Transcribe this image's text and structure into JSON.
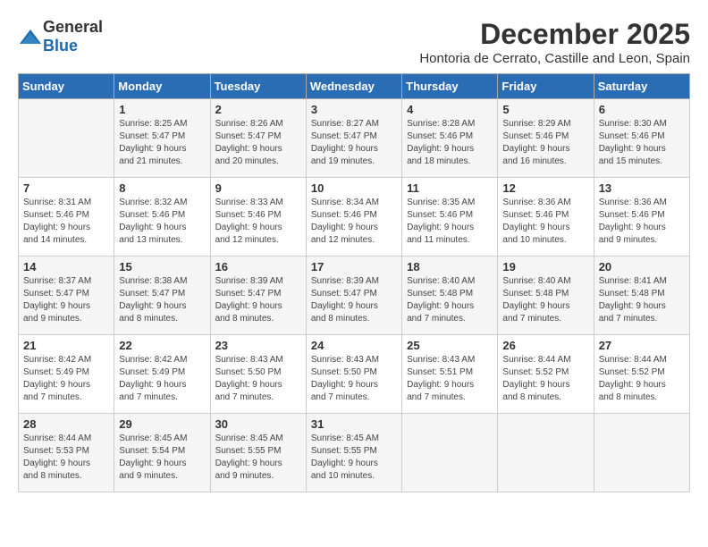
{
  "logo": {
    "text_general": "General",
    "text_blue": "Blue"
  },
  "title": "December 2025",
  "location": "Hontoria de Cerrato, Castille and Leon, Spain",
  "weekdays": [
    "Sunday",
    "Monday",
    "Tuesday",
    "Wednesday",
    "Thursday",
    "Friday",
    "Saturday"
  ],
  "weeks": [
    [
      {
        "day": "",
        "info": ""
      },
      {
        "day": "1",
        "info": "Sunrise: 8:25 AM\nSunset: 5:47 PM\nDaylight: 9 hours\nand 21 minutes."
      },
      {
        "day": "2",
        "info": "Sunrise: 8:26 AM\nSunset: 5:47 PM\nDaylight: 9 hours\nand 20 minutes."
      },
      {
        "day": "3",
        "info": "Sunrise: 8:27 AM\nSunset: 5:47 PM\nDaylight: 9 hours\nand 19 minutes."
      },
      {
        "day": "4",
        "info": "Sunrise: 8:28 AM\nSunset: 5:46 PM\nDaylight: 9 hours\nand 18 minutes."
      },
      {
        "day": "5",
        "info": "Sunrise: 8:29 AM\nSunset: 5:46 PM\nDaylight: 9 hours\nand 16 minutes."
      },
      {
        "day": "6",
        "info": "Sunrise: 8:30 AM\nSunset: 5:46 PM\nDaylight: 9 hours\nand 15 minutes."
      }
    ],
    [
      {
        "day": "7",
        "info": "Sunrise: 8:31 AM\nSunset: 5:46 PM\nDaylight: 9 hours\nand 14 minutes."
      },
      {
        "day": "8",
        "info": "Sunrise: 8:32 AM\nSunset: 5:46 PM\nDaylight: 9 hours\nand 13 minutes."
      },
      {
        "day": "9",
        "info": "Sunrise: 8:33 AM\nSunset: 5:46 PM\nDaylight: 9 hours\nand 12 minutes."
      },
      {
        "day": "10",
        "info": "Sunrise: 8:34 AM\nSunset: 5:46 PM\nDaylight: 9 hours\nand 12 minutes."
      },
      {
        "day": "11",
        "info": "Sunrise: 8:35 AM\nSunset: 5:46 PM\nDaylight: 9 hours\nand 11 minutes."
      },
      {
        "day": "12",
        "info": "Sunrise: 8:36 AM\nSunset: 5:46 PM\nDaylight: 9 hours\nand 10 minutes."
      },
      {
        "day": "13",
        "info": "Sunrise: 8:36 AM\nSunset: 5:46 PM\nDaylight: 9 hours\nand 9 minutes."
      }
    ],
    [
      {
        "day": "14",
        "info": "Sunrise: 8:37 AM\nSunset: 5:47 PM\nDaylight: 9 hours\nand 9 minutes."
      },
      {
        "day": "15",
        "info": "Sunrise: 8:38 AM\nSunset: 5:47 PM\nDaylight: 9 hours\nand 8 minutes."
      },
      {
        "day": "16",
        "info": "Sunrise: 8:39 AM\nSunset: 5:47 PM\nDaylight: 9 hours\nand 8 minutes."
      },
      {
        "day": "17",
        "info": "Sunrise: 8:39 AM\nSunset: 5:47 PM\nDaylight: 9 hours\nand 8 minutes."
      },
      {
        "day": "18",
        "info": "Sunrise: 8:40 AM\nSunset: 5:48 PM\nDaylight: 9 hours\nand 7 minutes."
      },
      {
        "day": "19",
        "info": "Sunrise: 8:40 AM\nSunset: 5:48 PM\nDaylight: 9 hours\nand 7 minutes."
      },
      {
        "day": "20",
        "info": "Sunrise: 8:41 AM\nSunset: 5:48 PM\nDaylight: 9 hours\nand 7 minutes."
      }
    ],
    [
      {
        "day": "21",
        "info": "Sunrise: 8:42 AM\nSunset: 5:49 PM\nDaylight: 9 hours\nand 7 minutes."
      },
      {
        "day": "22",
        "info": "Sunrise: 8:42 AM\nSunset: 5:49 PM\nDaylight: 9 hours\nand 7 minutes."
      },
      {
        "day": "23",
        "info": "Sunrise: 8:43 AM\nSunset: 5:50 PM\nDaylight: 9 hours\nand 7 minutes."
      },
      {
        "day": "24",
        "info": "Sunrise: 8:43 AM\nSunset: 5:50 PM\nDaylight: 9 hours\nand 7 minutes."
      },
      {
        "day": "25",
        "info": "Sunrise: 8:43 AM\nSunset: 5:51 PM\nDaylight: 9 hours\nand 7 minutes."
      },
      {
        "day": "26",
        "info": "Sunrise: 8:44 AM\nSunset: 5:52 PM\nDaylight: 9 hours\nand 8 minutes."
      },
      {
        "day": "27",
        "info": "Sunrise: 8:44 AM\nSunset: 5:52 PM\nDaylight: 9 hours\nand 8 minutes."
      }
    ],
    [
      {
        "day": "28",
        "info": "Sunrise: 8:44 AM\nSunset: 5:53 PM\nDaylight: 9 hours\nand 8 minutes."
      },
      {
        "day": "29",
        "info": "Sunrise: 8:45 AM\nSunset: 5:54 PM\nDaylight: 9 hours\nand 9 minutes."
      },
      {
        "day": "30",
        "info": "Sunrise: 8:45 AM\nSunset: 5:55 PM\nDaylight: 9 hours\nand 9 minutes."
      },
      {
        "day": "31",
        "info": "Sunrise: 8:45 AM\nSunset: 5:55 PM\nDaylight: 9 hours\nand 10 minutes."
      },
      {
        "day": "",
        "info": ""
      },
      {
        "day": "",
        "info": ""
      },
      {
        "day": "",
        "info": ""
      }
    ]
  ]
}
